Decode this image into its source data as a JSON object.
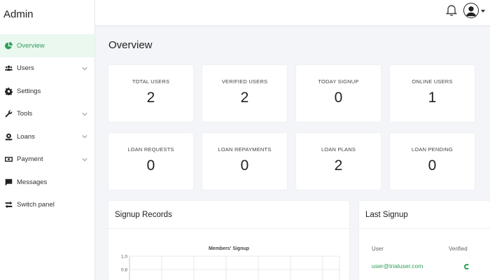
{
  "brand": "Admin",
  "sidebar": {
    "items": [
      {
        "label": "Overview",
        "icon": "pie-chart-icon",
        "active": true,
        "has_submenu": false
      },
      {
        "label": "Users",
        "icon": "users-icon",
        "active": false,
        "has_submenu": true
      },
      {
        "label": "Settings",
        "icon": "gear-icon",
        "active": false,
        "has_submenu": false
      },
      {
        "label": "Tools",
        "icon": "wrench-icon",
        "active": false,
        "has_submenu": true
      },
      {
        "label": "Loans",
        "icon": "loan-icon",
        "active": false,
        "has_submenu": true
      },
      {
        "label": "Payment",
        "icon": "payment-icon",
        "active": false,
        "has_submenu": true
      },
      {
        "label": "Messages",
        "icon": "message-icon",
        "active": false,
        "has_submenu": false
      },
      {
        "label": "Switch panel",
        "icon": "switch-icon",
        "active": false,
        "has_submenu": false
      }
    ]
  },
  "topbar": {
    "bell_icon": "bell-icon",
    "avatar_icon": "user-avatar-icon"
  },
  "page": {
    "title": "Overview"
  },
  "stats": [
    {
      "label": "TOTAL USERS",
      "value": "2"
    },
    {
      "label": "VERIFIED USERS",
      "value": "2"
    },
    {
      "label": "TODAY SIGNUP",
      "value": "0"
    },
    {
      "label": "ONLINE USERS",
      "value": "1"
    },
    {
      "label": "LOAN REQUESTS",
      "value": "0"
    },
    {
      "label": "LOAN REPAYMENTS",
      "value": "0"
    },
    {
      "label": "LOAN PLANS",
      "value": "2"
    },
    {
      "label": "LOAN PENDING",
      "value": "0"
    }
  ],
  "signup_records": {
    "title": "Signup Records",
    "chart_data": {
      "type": "line",
      "title": "Members' Signup",
      "y_ticks": [
        "1.0",
        "0.8"
      ],
      "ylim": [
        0,
        1.0
      ],
      "grid": true,
      "series": []
    }
  },
  "last_signup": {
    "title": "Last Signup",
    "columns": [
      "User",
      "Verified"
    ],
    "rows": [
      {
        "email": "user@trialuser.com"
      }
    ],
    "accent": "#2e9d58"
  }
}
